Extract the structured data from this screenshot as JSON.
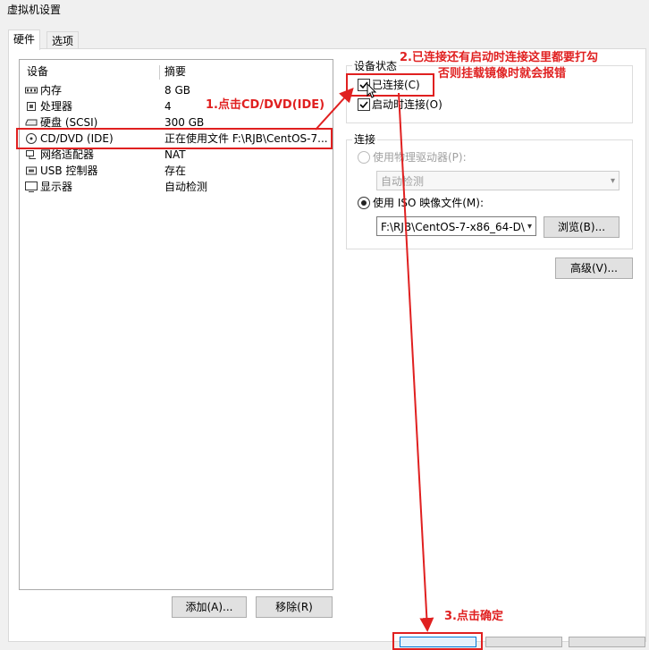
{
  "window": {
    "title": "虚拟机设置"
  },
  "tabs": [
    {
      "label": "硬件"
    },
    {
      "label": "选项"
    }
  ],
  "device_list": {
    "col_device": "设备",
    "col_summary": "摘要",
    "rows": [
      {
        "name": "内存",
        "summary": "8 GB",
        "icon": "memory-icon"
      },
      {
        "name": "处理器",
        "summary": "4",
        "icon": "cpu-icon"
      },
      {
        "name": "硬盘 (SCSI)",
        "summary": "300 GB",
        "icon": "disk-icon"
      },
      {
        "name": "CD/DVD (IDE)",
        "summary": "正在使用文件 F:\\RJB\\CentOS-7...",
        "icon": "cd-icon"
      },
      {
        "name": "网络适配器",
        "summary": "NAT",
        "icon": "network-icon"
      },
      {
        "name": "USB 控制器",
        "summary": "存在",
        "icon": "usb-icon"
      },
      {
        "name": "显示器",
        "summary": "自动检测",
        "icon": "monitor-icon"
      }
    ],
    "add_label": "添加(A)...",
    "remove_label": "移除(R)"
  },
  "device_status": {
    "title": "设备状态",
    "connected_label": "已连接(C)",
    "connect_on_start_label": "启动时连接(O)"
  },
  "connection": {
    "title": "连接",
    "physical_label": "使用物理驱动器(P):",
    "physical_value": "自动检测",
    "iso_label": "使用 ISO 映像文件(M):",
    "iso_value": "F:\\RJB\\CentOS-7-x86_64-D\\",
    "browse_label": "浏览(B)..."
  },
  "advanced_label": "高级(V)...",
  "annotations": {
    "step1": "1.点击CD/DVD(IDE)",
    "step2_line1": "2.已连接还有启动时连接这里都要打勾",
    "step2_line2": "否则挂载镜像时就会报错",
    "step3": "3.点击确定"
  },
  "colors": {
    "annotation": "#e02020",
    "accent": "#0078d7"
  }
}
